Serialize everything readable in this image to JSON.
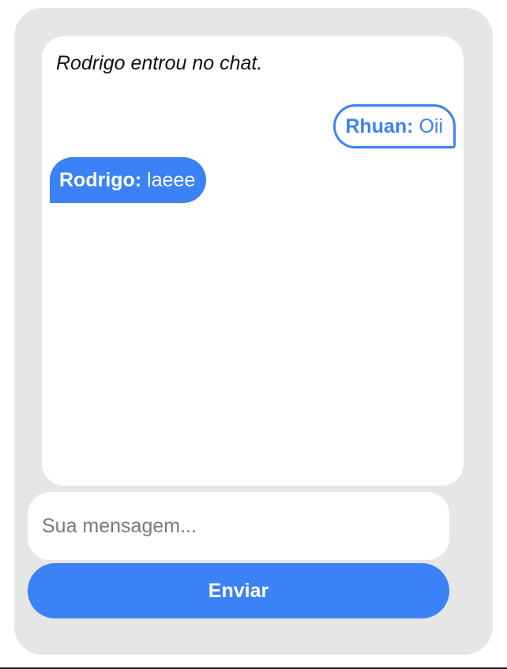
{
  "chat": {
    "system_message": "Rodrigo entrou no chat.",
    "messages": [
      {
        "author": "Rhuan:",
        "text": "Oii",
        "own": true
      },
      {
        "author": "Rodrigo:",
        "text": "laeee",
        "own": false
      }
    ]
  },
  "composer": {
    "placeholder": "Sua mensagem...",
    "value": "",
    "send_label": "Enviar"
  },
  "colors": {
    "accent": "#3b82f6",
    "card_background": "#e6e6e6",
    "panel_background": "#ffffff"
  }
}
